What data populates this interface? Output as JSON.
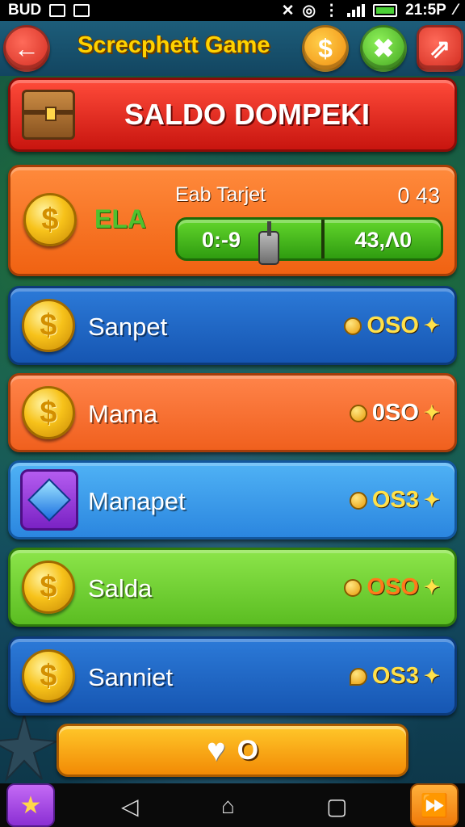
{
  "status_bar": {
    "left_text": "BUD",
    "time": "21:5P",
    "battery_pct_label": "⁄"
  },
  "header": {
    "title": "Screcphett Game",
    "back_icon": "←",
    "coin_icon": "$",
    "puzzle_icon": "✖",
    "share_icon": "⇗"
  },
  "banner": {
    "title": "SALDO DOMPEKI"
  },
  "target": {
    "coin_symbol": "$",
    "label_left": "ELA",
    "title": "Eab Tarjet",
    "value": "0 43",
    "progress_left": "0:-9",
    "progress_right": "43,Ʌ0",
    "progress_fraction": 0.55
  },
  "rows": [
    {
      "name": "Sanpet",
      "amount": "OSO",
      "style": "blue",
      "icon": "coin-icon",
      "amount_color": "#ffe14a"
    },
    {
      "name": "Mama",
      "amount": "0SO",
      "style": "orange",
      "icon": "coin-icon",
      "amount_color": "#ffffff"
    },
    {
      "name": "Manapet",
      "amount": "OS3",
      "style": "lightblue",
      "icon": "gem-icon",
      "amount_color": "#ffe14a"
    },
    {
      "name": "Salda",
      "amount": "OSO",
      "style": "green",
      "icon": "coin-icon",
      "amount_color": "#ff7a1a"
    },
    {
      "name": "Sanniet",
      "amount": "OS3",
      "style": "blue",
      "icon": "coin-icon",
      "amount_color": "#ffe14a"
    }
  ],
  "row_coin_symbol": "$",
  "row_sparkle": "✦",
  "bottom_button": {
    "heart_icon": "♥",
    "count": "O"
  },
  "nav": {
    "star_icon": "★",
    "back_icon": "◁",
    "home_icon": "⌂",
    "recent_icon": "▢",
    "ff_icon": "⏩"
  }
}
